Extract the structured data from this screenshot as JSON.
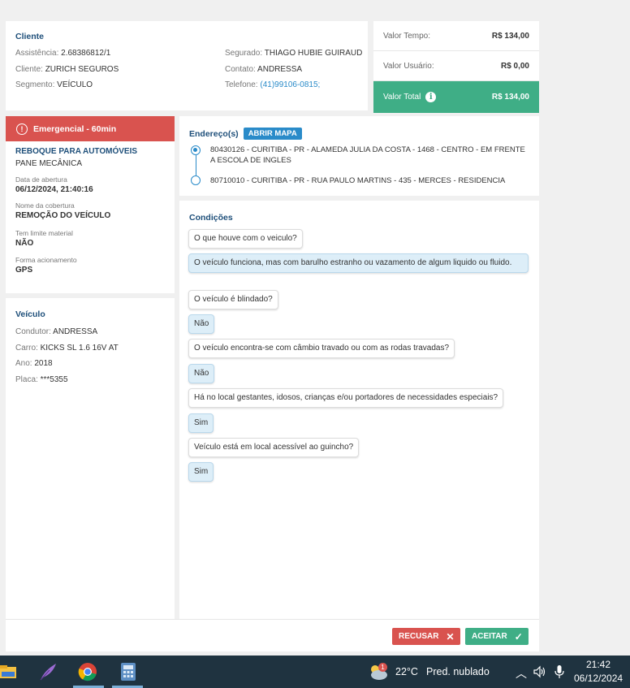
{
  "client": {
    "title": "Cliente",
    "assistencia_label": "Assistência:",
    "assistencia_value": "2.68386812/1",
    "cliente_label": "Cliente:",
    "cliente_value": "ZURICH SEGUROS",
    "segmento_label": "Segmento:",
    "segmento_value": "VEÍCULO",
    "segurado_label": "Segurado:",
    "segurado_value": "THIAGO HUBIE GUIRAUD",
    "contato_label": "Contato:",
    "contato_value": "ANDRESSA",
    "telefone_label": "Telefone:",
    "telefone_value": "(41)99106-0815;"
  },
  "values": {
    "tempo_label": "Valor Tempo:",
    "tempo_value": "R$ 134,00",
    "usuario_label": "Valor Usuário:",
    "usuario_value": "R$ 0,00",
    "total_label": "Valor Total",
    "total_value": "R$ 134,00",
    "info_glyph": "i"
  },
  "service": {
    "emergency_label": "Emergencial - 60min",
    "service_name": "REBOQUE PARA AUTOMÓVEIS",
    "service_type": "PANE MECÂNICA",
    "abertura_label": "Data de abertura",
    "abertura_value": "06/12/2024, 21:40:16",
    "cobertura_label": "Nome da cobertura",
    "cobertura_value": "REMOÇÃO DO VEÍCULO",
    "limite_label": "Tem limite material",
    "limite_value": "NÃO",
    "forma_label": "Forma acionamento",
    "forma_value": "GPS"
  },
  "vehicle": {
    "title": "Veículo",
    "condutor_label": "Condutor:",
    "condutor_value": "ANDRESSA",
    "carro_label": "Carro:",
    "carro_value": "KICKS SL 1.6 16V AT",
    "ano_label": "Ano:",
    "ano_value": "2018",
    "placa_label": "Placa:",
    "placa_value": "***5355"
  },
  "address": {
    "title": "Endereço(s)",
    "map_button": "ABRIR MAPA",
    "origin": "80430126 - CURITIBA - PR - ALAMEDA JULIA DA COSTA - 1468 - CENTRO - EM FRENTE A ESCOLA DE INGLES",
    "destination": "80710010 - CURITIBA - PR - RUA PAULO MARTINS - 435 - MERCES - RESIDENCIA"
  },
  "conditions": {
    "title": "Condições",
    "items": [
      {
        "q": "O que houve com o veiculo?",
        "a": "O veículo funciona, mas com barulho estranho ou vazamento de algum liquido ou fluido."
      },
      {
        "q": "O veículo é blindado?",
        "a": "Não"
      },
      {
        "q": "O veículo encontra-se com câmbio travado ou com as rodas travadas?",
        "a": "Não"
      },
      {
        "q": "Há no local gestantes, idosos, crianças e/ou portadores de necessidades especiais?",
        "a": "Sim"
      },
      {
        "q": "Veículo está em local acessível ao guincho?",
        "a": "Sim"
      }
    ]
  },
  "actions": {
    "refuse_label": "RECUSAR",
    "refuse_icon": "✕",
    "accept_label": "ACEITAR",
    "accept_icon": "✓"
  },
  "taskbar": {
    "weather_badge": "1",
    "temperature": "22°C",
    "weather_text": "Pred. nublado",
    "time": "21:42",
    "date": "06/12/2024"
  },
  "colors": {
    "accent": "#2a8bc9",
    "title": "#1e4f7a",
    "danger": "#d9534f",
    "success": "#3fae86",
    "taskbar": "#1f3340"
  }
}
